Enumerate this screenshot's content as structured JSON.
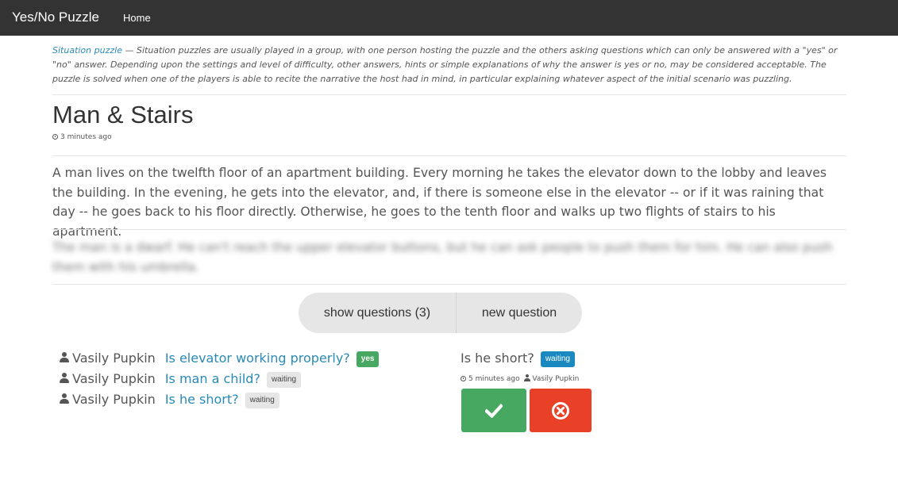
{
  "navbar": {
    "brand": "Yes/No Puzzle",
    "home_label": "Home"
  },
  "intro": {
    "link_text": "Situation puzzle",
    "text": " — Situation puzzles are usually played in a group, with one person hosting the puzzle and the others asking questions which can only be answered with a \"yes\" or \"no\" answer. Depending upon the settings and level of difficulty, other answers, hints or simple explanations of why the answer is yes or no, may be considered acceptable. The puzzle is solved when one of the players is able to recite the narrative the host had in mind, in particular explaining whatever aspect of the initial scenario was puzzling."
  },
  "puzzle": {
    "title": "Man & Stairs",
    "time_ago": "3 minutes ago",
    "text": "A man lives on the twelfth floor of an apartment building. Every morning he takes the elevator down to the lobby and leaves the building. In the evening, he gets into the elevator, and, if there is someone else in the elevator -- or if it was raining that day -- he goes back to his floor directly. Otherwise, he goes to the tenth floor and walks up two flights of stairs to his apartment.",
    "answer": "The man is a dwarf. He can't reach the upper elevator buttons, but he can ask people to push them for him. He can also push them with his umbrella."
  },
  "actions": {
    "show_questions": "show questions (3)",
    "new_question": "new question"
  },
  "questions": [
    {
      "user": "Vasily Pupkin",
      "text": "Is elevator working properly?",
      "status": "yes"
    },
    {
      "user": "Vasily Pupkin",
      "text": "Is man a child?",
      "status": "waiting"
    },
    {
      "user": "Vasily Pupkin",
      "text": "Is he short?",
      "status": "waiting"
    }
  ],
  "selected_question": {
    "text": "Is he short?",
    "status": "waiting",
    "time_ago": "5 minutes ago",
    "user": "Vasily Pupkin"
  },
  "icons": {
    "clock": "clock-icon",
    "user": "user-icon",
    "yes": "check-icon",
    "no": "times-circle-icon"
  },
  "colors": {
    "navbar": "#333333",
    "link": "#2a8ab7",
    "yes": "#47a862",
    "no": "#e94127",
    "waiting_blue": "#1a89bf",
    "waiting_gray": "#e6e6e6"
  }
}
